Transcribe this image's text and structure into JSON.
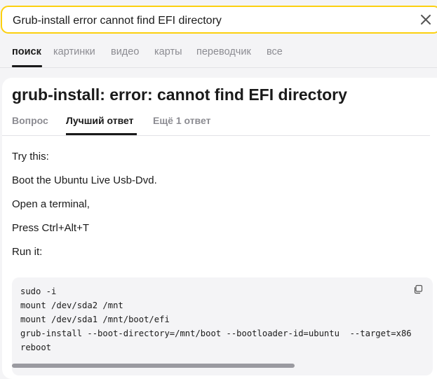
{
  "search": {
    "value": "Grub-install error cannot find EFI directory",
    "clear_icon": "close-icon"
  },
  "nav": {
    "tabs": [
      {
        "label": "поиск",
        "active": true
      },
      {
        "label": "картинки",
        "active": false
      },
      {
        "label": "видео",
        "active": false
      },
      {
        "label": "карты",
        "active": false
      },
      {
        "label": "переводчик",
        "active": false
      },
      {
        "label": "все",
        "active": false
      }
    ]
  },
  "card": {
    "title": "grub-install: error: cannot find EFI directory",
    "tabs": [
      {
        "label": "Вопрос",
        "active": false
      },
      {
        "label": "Лучший ответ",
        "active": true
      },
      {
        "label": "Ещё 1 ответ",
        "active": false
      }
    ],
    "paragraphs": [
      "Try this:",
      "Boot the Ubuntu Live Usb-Dvd.",
      "Open a terminal,",
      "Press Ctrl+Alt+T",
      "Run it:"
    ],
    "code_lines": [
      "sudo -i",
      "mount /dev/sda2 /mnt",
      "mount /dev/sda1 /mnt/boot/efi",
      "grub-install --boot-directory=/mnt/boot --bootloader-id=ubuntu  --target=x86",
      "reboot"
    ],
    "copy_icon": "copy-icon"
  },
  "colors": {
    "search_border": "#fcd00f",
    "page_bg": "#f4f4f6",
    "text": "#1a1a1a",
    "muted": "#8c8c92"
  }
}
